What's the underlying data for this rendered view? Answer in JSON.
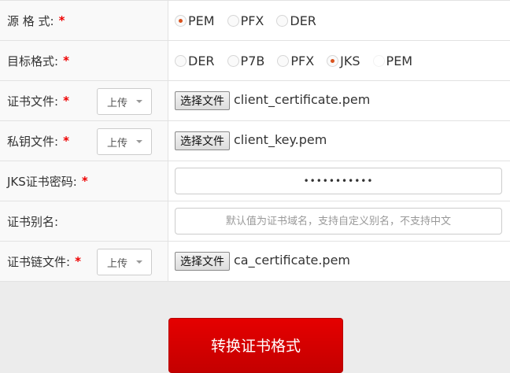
{
  "source_format": {
    "label": "源 格 式:",
    "required": "*",
    "options": [
      "PEM",
      "PFX",
      "DER"
    ],
    "selected": "PEM"
  },
  "target_format": {
    "label": "目标格式:",
    "required": "*",
    "options": [
      "DER",
      "P7B",
      "PFX",
      "JKS",
      "PEM"
    ],
    "selected": "JKS"
  },
  "cert_file": {
    "label": "证书文件:",
    "required": "*",
    "upload_select": "上传",
    "choose_button": "选择文件",
    "file_name": "client_certificate.pem"
  },
  "key_file": {
    "label": "私钥文件:",
    "required": "*",
    "upload_select": "上传",
    "choose_button": "选择文件",
    "file_name": "client_key.pem"
  },
  "jks_password": {
    "label": "JKS证书密码:",
    "required": "*",
    "value": "•••••••••••"
  },
  "cert_alias": {
    "label": "证书别名:",
    "placeholder": "默认值为证书域名，支持自定义别名，不支持中文"
  },
  "chain_file": {
    "label": "证书链文件:",
    "required": "*",
    "upload_select": "上传",
    "choose_button": "选择文件",
    "file_name": "ca_certificate.pem"
  },
  "submit": {
    "label": "转换证书格式"
  },
  "colors": {
    "accent": "#d9531e",
    "required": "#ee0000",
    "button_red": "#d40000"
  }
}
